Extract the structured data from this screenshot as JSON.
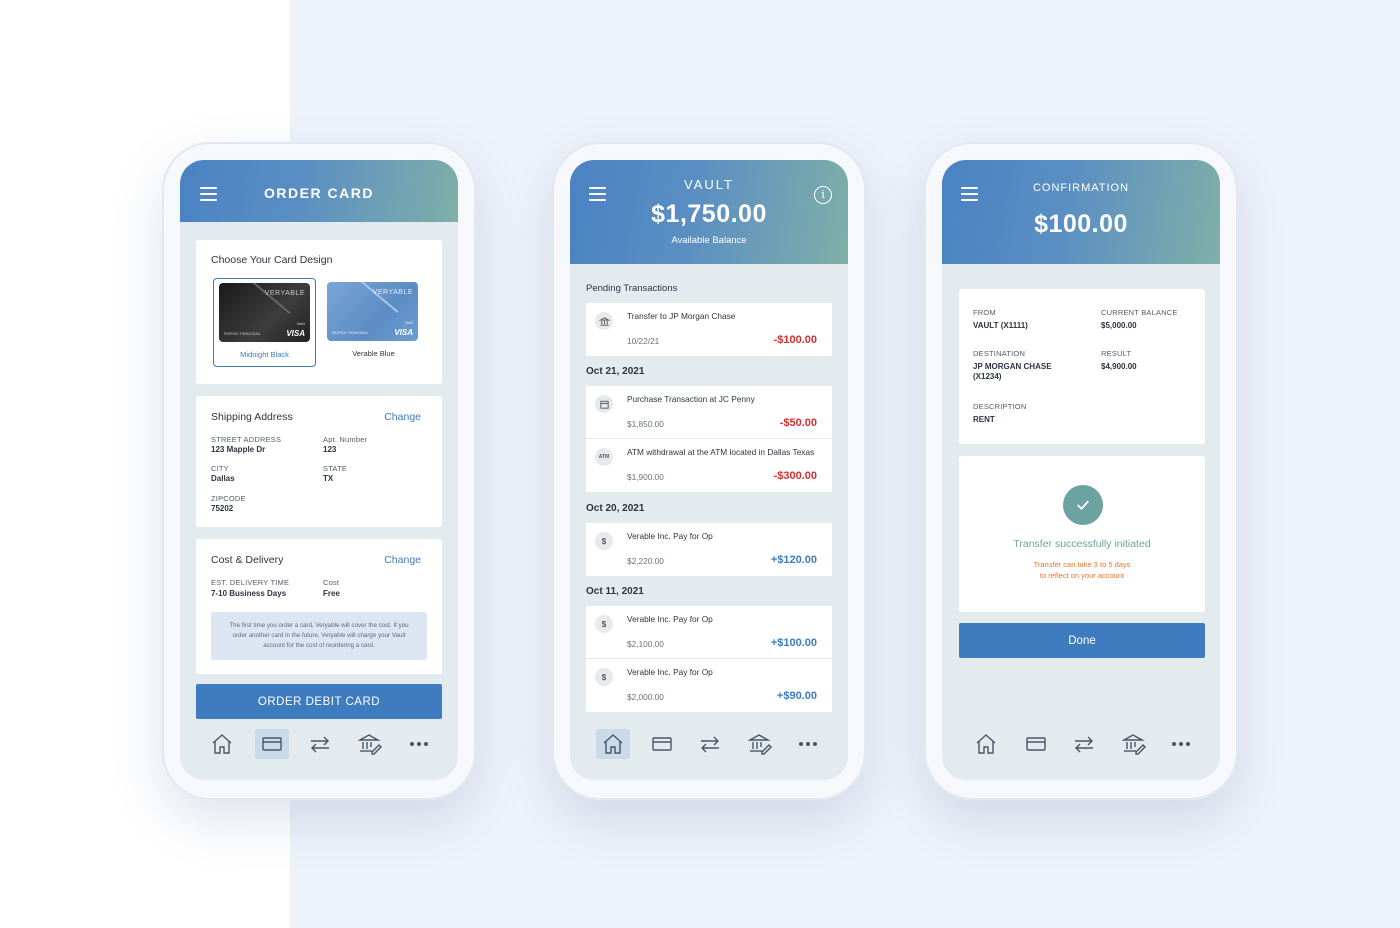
{
  "colors": {
    "primary": "#3f7bbf",
    "accent_teal": "#79aba6",
    "negative": "#d32f2f",
    "positive": "#3c7cc2",
    "warning": "#e8742c"
  },
  "order": {
    "title": "ORDER CARD",
    "design_title": "Choose Your Card Design",
    "cards": [
      {
        "name": "Midnight Black",
        "brand": "VERYABLE",
        "holder": "PATRICK THIBODEAU",
        "type": "Debit",
        "network": "VISA"
      },
      {
        "name": "Verable Blue",
        "brand": "VERYABLE",
        "holder": "PATRICK THIBODEAU",
        "type": "Debit",
        "network": "VISA"
      }
    ],
    "shipping": {
      "title": "Shipping Address",
      "change": "Change",
      "street_label": "STREET ADDRESS",
      "street": "123 Mapple Dr",
      "apt_label": "Apt. Number",
      "apt": "123",
      "city_label": "CITY",
      "city": "Dallas",
      "state_label": "STATE",
      "state": "TX",
      "zip_label": "ZIPCODE",
      "zip": "75202"
    },
    "cost": {
      "title": "Cost & Delivery",
      "change": "Change",
      "eta_label": "EST. DELIVERY TIME",
      "eta": "7-10 Business Days",
      "cost_label": "Cost",
      "cost": "Free",
      "note": "The first time you order a card, Veryable will cover the cost. If you order another card in the future, Veryable will charge your Vault account for the cost of reordering a card."
    },
    "button": "ORDER DEBIT CARD"
  },
  "home": {
    "logo": "VAULT",
    "balance": "$1,750.00",
    "balance_label": "Available Balance",
    "pending_title": "Pending Transactions",
    "pending": [
      {
        "title": "Transfer to JP Morgan Chase",
        "sub": "10/22/21",
        "amount": "-$100.00"
      }
    ],
    "groups": [
      {
        "date": "Oct 21, 2021",
        "items": [
          {
            "icon": "store",
            "title": "Purchase Transaction at JC Penny",
            "sub": "$1,850.00",
            "amount": "-$50.00"
          },
          {
            "icon": "ATM",
            "title": "ATM withdrawal at the ATM located in Dallas Texas",
            "sub": "$1,900.00",
            "amount": "-$300.00"
          }
        ]
      },
      {
        "date": "Oct 20, 2021",
        "items": [
          {
            "icon": "$",
            "title": "Verable Inc. Pay for Op",
            "sub": "$2,220.00",
            "amount": "+$120.00"
          }
        ]
      },
      {
        "date": "Oct 11, 2021",
        "items": [
          {
            "icon": "$",
            "title": "Verable Inc. Pay for Op",
            "sub": "$2,100.00",
            "amount": "+$100.00"
          },
          {
            "icon": "$",
            "title": "Verable Inc. Pay for Op",
            "sub": "$2,000.00",
            "amount": "+$90.00"
          }
        ]
      }
    ]
  },
  "confirm": {
    "title": "CONFIRMATION",
    "amount": "$100.00",
    "from_label": "FROM",
    "from": "VAULT (X1111)",
    "balance_label": "CURRENT BALANCE",
    "balance": "$5,000.00",
    "dest_label": "DESTINATION",
    "dest": "JP MORGAN CHASE (X1234)",
    "result_label": "RESULT",
    "result": "$4,900.00",
    "desc_label": "DESCRIPTION",
    "desc": "RENT",
    "success": "Transfer successfully initiated",
    "note_line1": "Transfer can take 3 to 5 days",
    "note_line2": "to reflect on your account",
    "done": "Done"
  },
  "tabs": [
    "home-icon",
    "card-icon",
    "transfer-icon",
    "bank-icon",
    "more-icon"
  ]
}
